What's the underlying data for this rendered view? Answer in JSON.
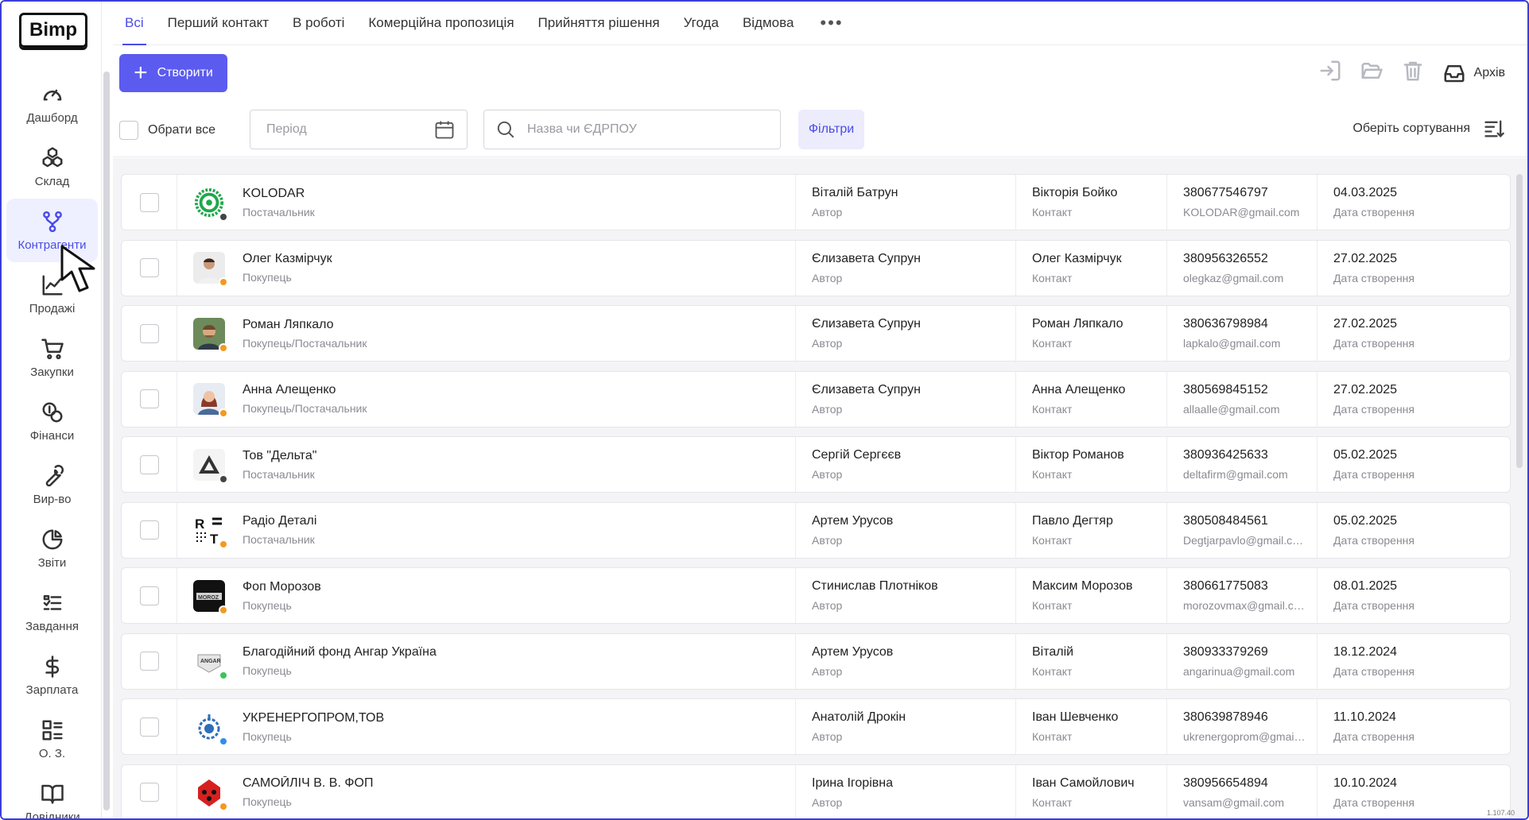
{
  "app": {
    "logo": "Bimp",
    "version": "1.107.40"
  },
  "sidebar": {
    "items": [
      {
        "label": "Дашборд",
        "icon": "gauge-icon"
      },
      {
        "label": "Склад",
        "icon": "boxes-icon"
      },
      {
        "label": "Контрагенти",
        "icon": "network-icon",
        "active": true
      },
      {
        "label": "Продажі",
        "icon": "chart-line-icon"
      },
      {
        "label": "Закупки",
        "icon": "cart-icon"
      },
      {
        "label": "Фінанси",
        "icon": "coins-icon"
      },
      {
        "label": "Вир-во",
        "icon": "wrench-icon"
      },
      {
        "label": "Звіти",
        "icon": "pie-chart-icon"
      },
      {
        "label": "Завдання",
        "icon": "task-list-icon"
      },
      {
        "label": "Зарплата",
        "icon": "dollar-icon"
      },
      {
        "label": "О. З.",
        "icon": "grid-list-icon"
      },
      {
        "label": "Довідники",
        "icon": "book-icon"
      }
    ]
  },
  "tabs": [
    {
      "label": "Всі",
      "active": true
    },
    {
      "label": "Перший контакт"
    },
    {
      "label": "В роботі"
    },
    {
      "label": "Комерційна пропозиція"
    },
    {
      "label": "Прийняття рішення"
    },
    {
      "label": "Угода"
    },
    {
      "label": "Відмова"
    }
  ],
  "tabs_more": "•••",
  "toolbar": {
    "create_label": "Створити",
    "archive_label": "Архів"
  },
  "filters": {
    "select_all": "Обрати все",
    "period_placeholder": "Період",
    "search_placeholder": "Назва чи ЄДРПОУ",
    "filters_label": "Фільтри",
    "sort_label": "Оберіть сортування"
  },
  "colors": {
    "accent": "#5b5bf0",
    "status_orange": "#f39a1e",
    "status_grey": "#444444",
    "status_green": "#3cc45a",
    "status_blue": "#2f8fe8"
  },
  "rows": [
    {
      "name": "KOLODAR",
      "type": "Постачальник",
      "author": "Віталій Батрун",
      "author_label": "Автор",
      "contact": "Вікторія Бойко",
      "contact_label": "Контакт",
      "phone": "380677546797",
      "email": "KOLODAR@gmail.com",
      "date": "04.03.2025",
      "date_label": "Дата створення",
      "status": "grey",
      "logo": "kolodar"
    },
    {
      "name": "Олег Казмірчук",
      "type": "Покупець",
      "author": "Єлизавета Супрун",
      "author_label": "Автор",
      "contact": "Олег Казмірчук",
      "contact_label": "Контакт",
      "phone": "380956326552",
      "email": "olegkaz@gmail.com",
      "date": "27.02.2025",
      "date_label": "Дата створення",
      "status": "orange",
      "logo": "person1"
    },
    {
      "name": "Роман Ляпкало",
      "type": "Покупець/Постачальник",
      "author": "Єлизавета Супрун",
      "author_label": "Автор",
      "contact": "Роман Ляпкало",
      "contact_label": "Контакт",
      "phone": "380636798984",
      "email": "lapkalo@gmail.com",
      "date": "27.02.2025",
      "date_label": "Дата створення",
      "status": "orange",
      "logo": "person2"
    },
    {
      "name": "Анна Алещенко",
      "type": "Покупець/Постачальник",
      "author": "Єлизавета Супрун",
      "author_label": "Автор",
      "contact": "Анна Алещенко",
      "contact_label": "Контакт",
      "phone": "380569845152",
      "email": "allaalle@gmail.com",
      "date": "27.02.2025",
      "date_label": "Дата створення",
      "status": "orange",
      "logo": "person3"
    },
    {
      "name": "Тов \"Дельта\"",
      "type": "Постачальник",
      "author": "Сергій Сергєєв",
      "author_label": "Автор",
      "contact": "Віктор Романов",
      "contact_label": "Контакт",
      "phone": "380936425633",
      "email": "deltafirm@gmail.com",
      "date": "05.02.2025",
      "date_label": "Дата створення",
      "status": "grey",
      "logo": "delta"
    },
    {
      "name": "Радіо Деталі",
      "type": "Постачальник",
      "author": "Артем Урусов",
      "author_label": "Автор",
      "contact": "Павло Дегтяр",
      "contact_label": "Контакт",
      "phone": "380508484561",
      "email": "Degtjarpavlo@gmail.com",
      "date": "05.02.2025",
      "date_label": "Дата створення",
      "status": "orange",
      "logo": "rt"
    },
    {
      "name": "Фоп Морозов",
      "type": "Покупець",
      "author": "Стинислав Плотніков",
      "author_label": "Автор",
      "contact": "Максим Морозов",
      "contact_label": "Контакт",
      "phone": "380661775083",
      "email": "morozovmax@gmail.com",
      "date": "08.01.2025",
      "date_label": "Дата створення",
      "status": "orange",
      "logo": "morozov"
    },
    {
      "name": "Благодійний фонд Ангар Україна",
      "type": "Покупець",
      "author": "Артем Урусов",
      "author_label": "Автор",
      "contact": "Віталій",
      "contact_label": "Контакт",
      "phone": "380933379269",
      "email": "angarinua@gmail.com",
      "date": "18.12.2024",
      "date_label": "Дата створення",
      "status": "green",
      "logo": "angar"
    },
    {
      "name": "УКРЕНЕРГОПРОМ,ТОВ",
      "type": "Покупець",
      "author": "Анатолій Дрокін",
      "author_label": "Автор",
      "contact": "Іван Шевченко",
      "contact_label": "Контакт",
      "phone": "380639878946",
      "email": "ukrenergoprom@gmail.com",
      "date": "11.10.2024",
      "date_label": "Дата створення",
      "status": "blue",
      "logo": "ukrenergo"
    },
    {
      "name": "САМОЙЛІЧ В. В. ФОП",
      "type": "Покупець",
      "author": "Ірина Ігорівна",
      "author_label": "Автор",
      "contact": "Іван Самойлович",
      "contact_label": "Контакт",
      "phone": "380956654894",
      "email": "vansam@gmail.com",
      "date": "10.10.2024",
      "date_label": "Дата створення",
      "status": "orange",
      "logo": "samoilich"
    }
  ]
}
